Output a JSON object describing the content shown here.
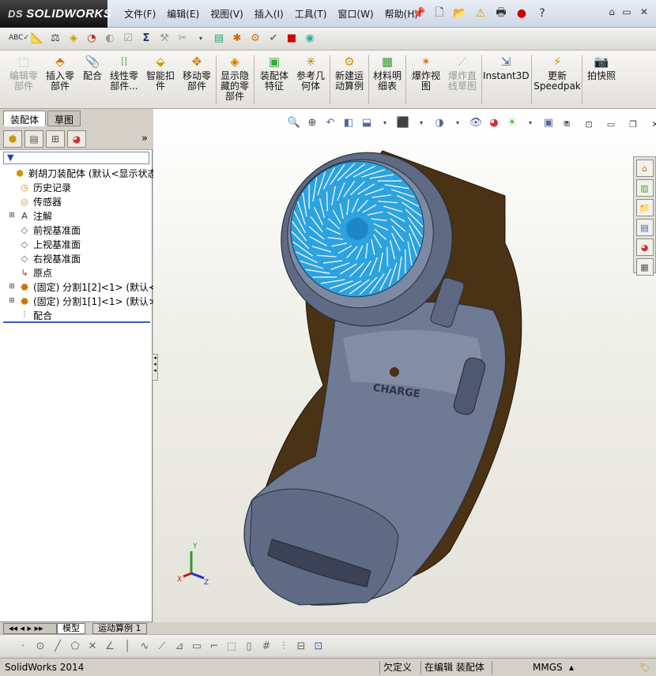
{
  "app": {
    "logo": "SOLIDWORKS",
    "logo_prefix": "DS"
  },
  "menu": [
    "文件(F)",
    "编辑(E)",
    "视图(V)",
    "插入(I)",
    "工具(T)",
    "窗口(W)",
    "帮助(H)"
  ],
  "window_controls": [
    "⌂",
    "▭",
    "✕"
  ],
  "command_manager": [
    {
      "label": "编辑零\n部件",
      "disabled": true
    },
    {
      "label": "插入零\n部件",
      "disabled": false
    },
    {
      "label": "配合",
      "disabled": false
    },
    {
      "label": "线性零\n部件...",
      "disabled": false
    },
    {
      "label": "智能扣\n件",
      "disabled": false
    },
    {
      "label": "移动零\n部件",
      "disabled": false
    },
    {
      "label": "显示隐\n藏的零\n部件",
      "disabled": false
    },
    {
      "label": "装配体\n特征",
      "disabled": false
    },
    {
      "label": "参考几\n何体",
      "disabled": false
    },
    {
      "label": "新建运\n动算例",
      "disabled": false
    },
    {
      "label": "材料明\n细表",
      "disabled": false
    },
    {
      "label": "爆炸视\n图",
      "disabled": false
    },
    {
      "label": "爆炸直\n线草图",
      "disabled": true
    },
    {
      "label": "Instant3D",
      "disabled": false
    },
    {
      "label": "更新\nSpeedpak",
      "disabled": false
    },
    {
      "label": "拍快照",
      "disabled": false
    }
  ],
  "left_panel": {
    "tabs": [
      "装配体",
      "草图"
    ],
    "filter_icon": "filter-icon",
    "tree": [
      {
        "label": "剃胡刀装配体  (默认<显示状态",
        "icon": "assembly-icon",
        "expander": "",
        "indent": 0
      },
      {
        "label": "历史记录",
        "icon": "history-icon",
        "expander": "",
        "indent": 1
      },
      {
        "label": "传感器",
        "icon": "sensor-icon",
        "expander": "",
        "indent": 1
      },
      {
        "label": "注解",
        "icon": "annotation-icon",
        "expander": "+",
        "indent": 1
      },
      {
        "label": "前视基准面",
        "icon": "plane-icon",
        "expander": "",
        "indent": 1
      },
      {
        "label": "上视基准面",
        "icon": "plane-icon",
        "expander": "",
        "indent": 1
      },
      {
        "label": "右视基准面",
        "icon": "plane-icon",
        "expander": "",
        "indent": 1
      },
      {
        "label": "原点",
        "icon": "origin-icon",
        "expander": "",
        "indent": 1
      },
      {
        "label": "(固定) 分割1[2]<1> (默认<",
        "icon": "part-icon",
        "expander": "+",
        "indent": 1
      },
      {
        "label": "(固定) 分割1[1]<1> (默认>",
        "icon": "part-icon",
        "expander": "+",
        "indent": 1
      },
      {
        "label": "配合",
        "icon": "mate-icon",
        "expander": "",
        "indent": 1
      }
    ],
    "bottom_tabs": [
      "模型",
      "运动算例 1"
    ]
  },
  "viewport": {
    "model_label": "CHARGE",
    "triad": {
      "x": "X",
      "y": "Y",
      "z": "Z"
    }
  },
  "status_bar": {
    "app_version": "SolidWorks 2014",
    "undefined": "欠定义",
    "editing": "在编辑 装配体",
    "units": "MMGS",
    "help": "?"
  },
  "colors": {
    "body_gray": "#6f7a94",
    "brown": "#4a3214",
    "head_blue": "#2ca3df",
    "accent": "#3464b4"
  }
}
